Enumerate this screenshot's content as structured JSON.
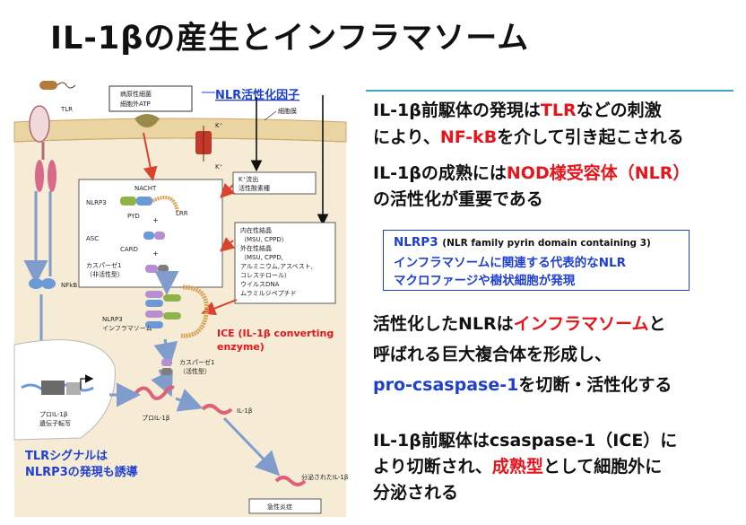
{
  "title": "IL-1βの産生とインフラマソーム",
  "colors": {
    "accent_red": "#e8141b",
    "accent_blue": "#1f3fd1",
    "rule": "#3aa6c8",
    "cell_bg": "#f6ecd6"
  },
  "bullets": {
    "b1": {
      "l1_a": "IL-1β前駆体の発現は",
      "l1_b": "TLR",
      "l1_c": "などの刺激",
      "l2_a": "により、",
      "l2_b": "NF-kB",
      "l2_c": "を介して引き起こされる"
    },
    "b2": {
      "l1_a": "IL-1βの成熟には",
      "l1_b": "NOD様受容体（NLR）",
      "l2": "の活性化が重要である"
    },
    "b3": {
      "l1_a": "活性化したNLRは",
      "l1_b": "インフラマソーム",
      "l1_c": "と",
      "l2": "呼ばれる巨大複合体を形成し、",
      "l3_a": "pro-csaspase-1",
      "l3_b": "を切断・活性化する"
    },
    "b4": {
      "l1": "IL-1β前駆体はcsaspase-1（ICE）に",
      "l2_a": "より切断され、",
      "l2_b": "成熟型",
      "l2_c": "として細胞外に",
      "l3": "分泌される"
    }
  },
  "nlrp3_box": {
    "line1": "NLRP3",
    "line1_sub": "(NLR family pyrin domain containing 3)",
    "line2": "インフラマソームに関連する代表的なNLR",
    "line3": "マクロファージや樹状細胞が発現"
  },
  "diagram": {
    "nlr_activator": "NLR活性化因子",
    "pathogen_1": "病原性細菌",
    "pathogen_2": "細胞外ATP",
    "tlr": "TLR",
    "membrane": "細胞膜",
    "k_plus": "K⁺",
    "k_out_1": "K⁺流出",
    "k_out_2": "活性酸素種",
    "nacht": "NACHT",
    "nlrp3": "NLRP3",
    "pyd": "PYD",
    "lrr": "LRR",
    "asc": "ASC",
    "card": "CARD",
    "casp1_1": "カスパーゼ1",
    "casp1_2": "（非活性型）",
    "crystal_lines": [
      "内在性結晶",
      "（MSU, CPPD）",
      "外在性結晶",
      "（MSU, CPPD,",
      "アルミニウム,アスベスト,",
      "コレステロール）",
      "ウイルスDNA",
      "ムラミルジペプチド"
    ],
    "nfkb": "NFkB",
    "inflam_1": "NLRP3",
    "inflam_2": "インフラマソーム",
    "ice_1": "ICE (IL-1β converting",
    "ice_2": "enzyme)",
    "casp_active_1": "カスパーゼ1",
    "casp_active_2": "（活性型）",
    "gene_1": "プロIL-1β",
    "gene_2": "遺伝子転写",
    "pro_il1b": "プロIL-1β",
    "il1b": "IL-1β",
    "secreted": "分泌されたIL-1β",
    "inflammation": "急性炎症",
    "tlr_signal_1": "TLRシグナルは",
    "tlr_signal_2": "NLRP3の発現も誘導"
  }
}
